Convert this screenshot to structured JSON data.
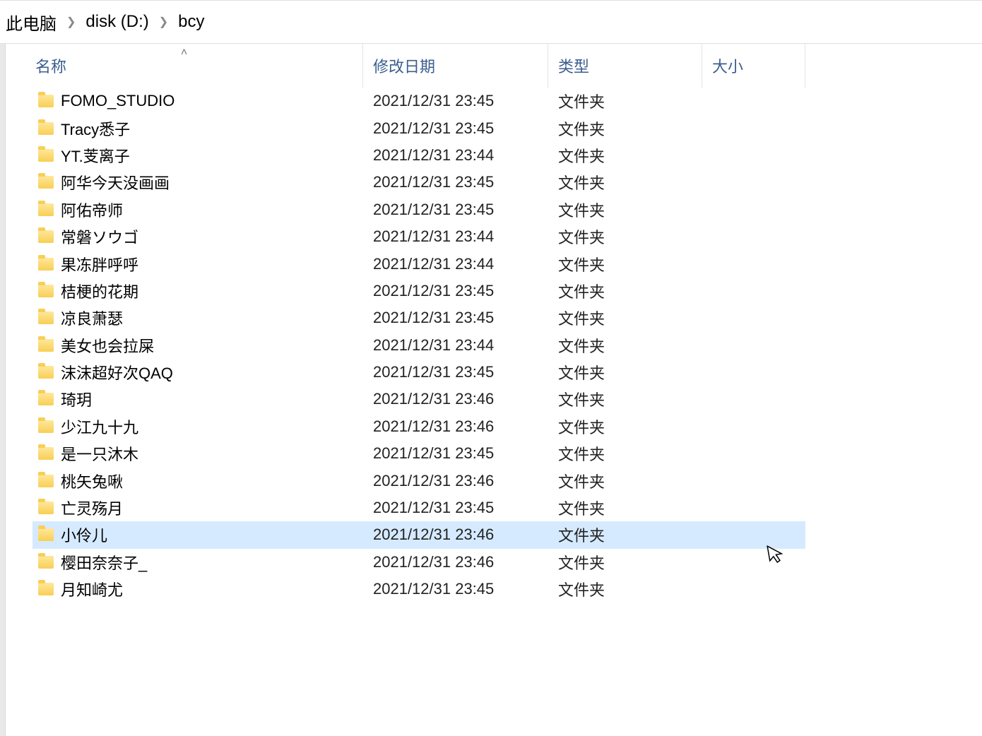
{
  "breadcrumb": {
    "items": [
      "此电脑",
      "disk (D:)",
      "bcy"
    ]
  },
  "columns": {
    "name": "名称",
    "date": "修改日期",
    "type": "类型",
    "size": "大小"
  },
  "type_label": "文件夹",
  "selected_index": 16,
  "items": [
    {
      "name": "FOMO_STUDIO",
      "date": "2021/12/31 23:45"
    },
    {
      "name": "Tracy悉子",
      "date": "2021/12/31 23:45"
    },
    {
      "name": "YT.芰离子",
      "date": "2021/12/31 23:44"
    },
    {
      "name": "阿华今天没画画",
      "date": "2021/12/31 23:45"
    },
    {
      "name": "阿佑帝师",
      "date": "2021/12/31 23:45"
    },
    {
      "name": "常磐ソウゴ",
      "date": "2021/12/31 23:44"
    },
    {
      "name": "果冻胖呼呼",
      "date": "2021/12/31 23:44"
    },
    {
      "name": "桔梗的花期",
      "date": "2021/12/31 23:45"
    },
    {
      "name": "凉良萧瑟",
      "date": "2021/12/31 23:45"
    },
    {
      "name": "美女也会拉屎",
      "date": "2021/12/31 23:44"
    },
    {
      "name": "沫沫超好次QAQ",
      "date": "2021/12/31 23:45"
    },
    {
      "name": "琦玥",
      "date": "2021/12/31 23:46"
    },
    {
      "name": "少江九十九",
      "date": "2021/12/31 23:46"
    },
    {
      "name": "是一只沐木",
      "date": "2021/12/31 23:45"
    },
    {
      "name": "桃矢兔啾",
      "date": "2021/12/31 23:46"
    },
    {
      "name": "亡灵殇月",
      "date": "2021/12/31 23:45"
    },
    {
      "name": "小伶儿",
      "date": "2021/12/31 23:46"
    },
    {
      "name": "樱田奈奈子_",
      "date": "2021/12/31 23:46"
    },
    {
      "name": "月知崎尤",
      "date": "2021/12/31 23:45"
    }
  ]
}
